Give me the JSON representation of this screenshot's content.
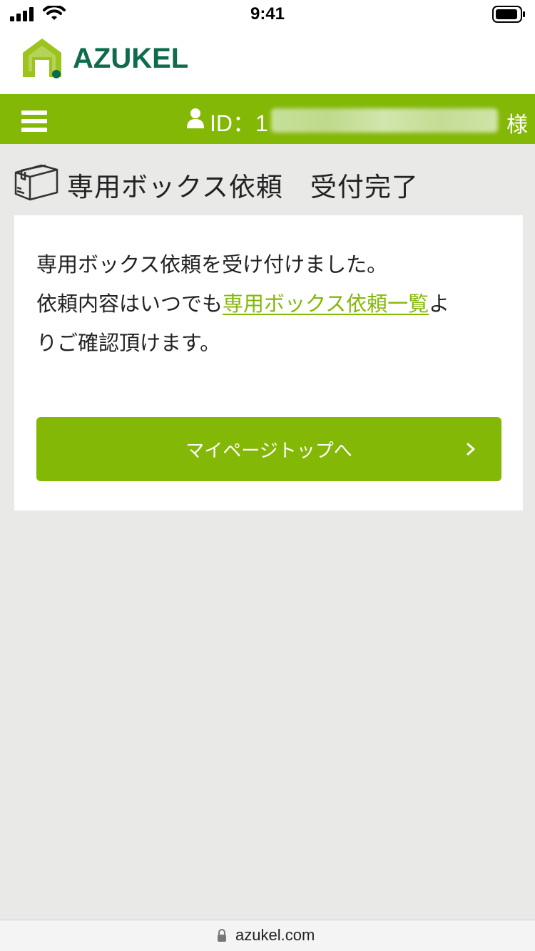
{
  "status_bar": {
    "time": "9:41",
    "icons": [
      "signal-icon",
      "wifi-icon",
      "battery-icon"
    ]
  },
  "header": {
    "logo_text": "AZUKEL"
  },
  "nav": {
    "user_prefix": "ID：1",
    "honorific": "様"
  },
  "page": {
    "title": "専用ボックス依頼　受付完了"
  },
  "message": {
    "line1": "専用ボックス依頼を受け付けました。",
    "line2_before": "依頼内容はいつでも",
    "line2_link": "専用ボックス依頼一覧",
    "line2_after": "よ",
    "line3": "りご確認頂けます。"
  },
  "button": {
    "label": "マイページトップへ"
  },
  "browser": {
    "url": "azukel.com"
  },
  "colors": {
    "brand_green": "#84b807",
    "logo_green": "#0f6b4c",
    "background": "#e9e9e8"
  }
}
